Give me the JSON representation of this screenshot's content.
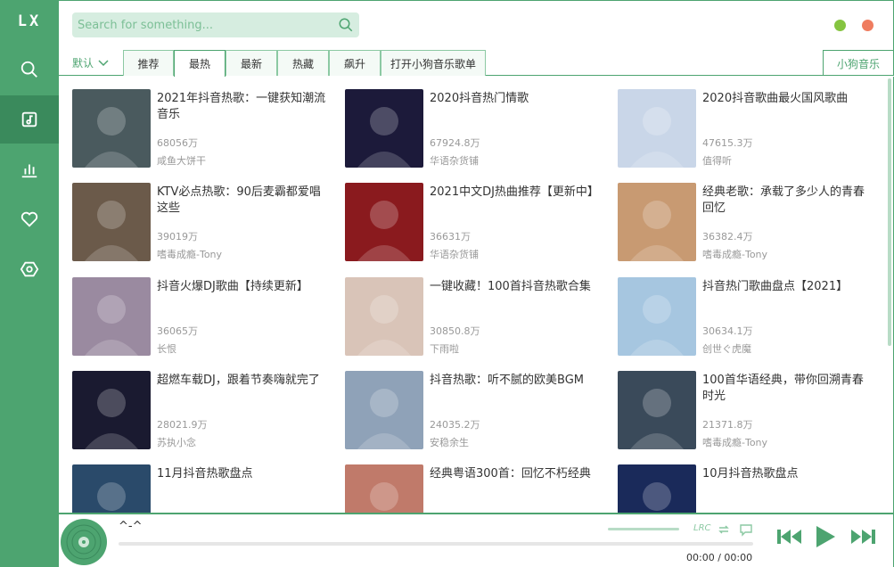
{
  "app": {
    "logo": "LX"
  },
  "search": {
    "placeholder": "Search for something..."
  },
  "sort": {
    "label": "默认"
  },
  "tabs": [
    "推荐",
    "最热",
    "最新",
    "热藏",
    "飙升",
    "打开小狗音乐歌单"
  ],
  "active_tab": "最热",
  "source": "小狗音乐",
  "playlists": [
    {
      "title": "2021年抖音热歌：一键获知潮流音乐",
      "count": "68056万",
      "author": "咸鱼大饼干"
    },
    {
      "title": "2020抖音热门情歌",
      "count": "67924.8万",
      "author": "华语杂货铺"
    },
    {
      "title": "2020抖音歌曲最火国风歌曲",
      "count": "47615.3万",
      "author": "值得听"
    },
    {
      "title": "KTV必点热歌：90后麦霸都爱唱这些",
      "count": "39019万",
      "author": "嗜毒成瘾-Tony"
    },
    {
      "title": "2021中文DJ热曲推荐【更新中】",
      "count": "36631万",
      "author": "华语杂货铺"
    },
    {
      "title": "经典老歌：承载了多少人的青春回忆",
      "count": "36382.4万",
      "author": "嗜毒成瘾-Tony"
    },
    {
      "title": "抖音火爆DJ歌曲【持续更新】",
      "count": "36065万",
      "author": "长恨"
    },
    {
      "title": "一键收藏！100首抖音热歌合集",
      "count": "30850.8万",
      "author": "下雨啦"
    },
    {
      "title": "抖音热门歌曲盘点【2021】",
      "count": "30634.1万",
      "author": "创世ぐ虎魔"
    },
    {
      "title": "超燃车载DJ，跟着节奏嗨就完了",
      "count": "28021.9万",
      "author": "苏执小念"
    },
    {
      "title": "抖音热歌：听不腻的欧美BGM",
      "count": "24035.2万",
      "author": "安稳余生"
    },
    {
      "title": "100首华语经典，带你回溯青春时光",
      "count": "21371.8万",
      "author": "嗜毒成瘾-Tony"
    },
    {
      "title": "11月抖音热歌盘点",
      "count": "",
      "author": ""
    },
    {
      "title": "经典粤语300首：回忆不朽经典",
      "count": "",
      "author": ""
    },
    {
      "title": "10月抖音热歌盘点",
      "count": "",
      "author": ""
    }
  ],
  "cover_colors": [
    "#4a5a5e",
    "#1c1a3a",
    "#c9d6e8",
    "#6b5a4a",
    "#8a1a1e",
    "#c89a72",
    "#9a8aa0",
    "#d9c4b8",
    "#a6c6e0",
    "#1a1a30",
    "#8fa2b8",
    "#3a4a5a",
    "#2a4a6a",
    "#c07a6a",
    "#1a2a5a"
  ],
  "player": {
    "song": "^-^",
    "time": "00:00 / 00:00",
    "lrc": "LRC"
  },
  "colors": {
    "accent": "#4da470",
    "accent_dark": "#3a8a5c",
    "min": "#85c440",
    "close": "#ef7c5f"
  }
}
